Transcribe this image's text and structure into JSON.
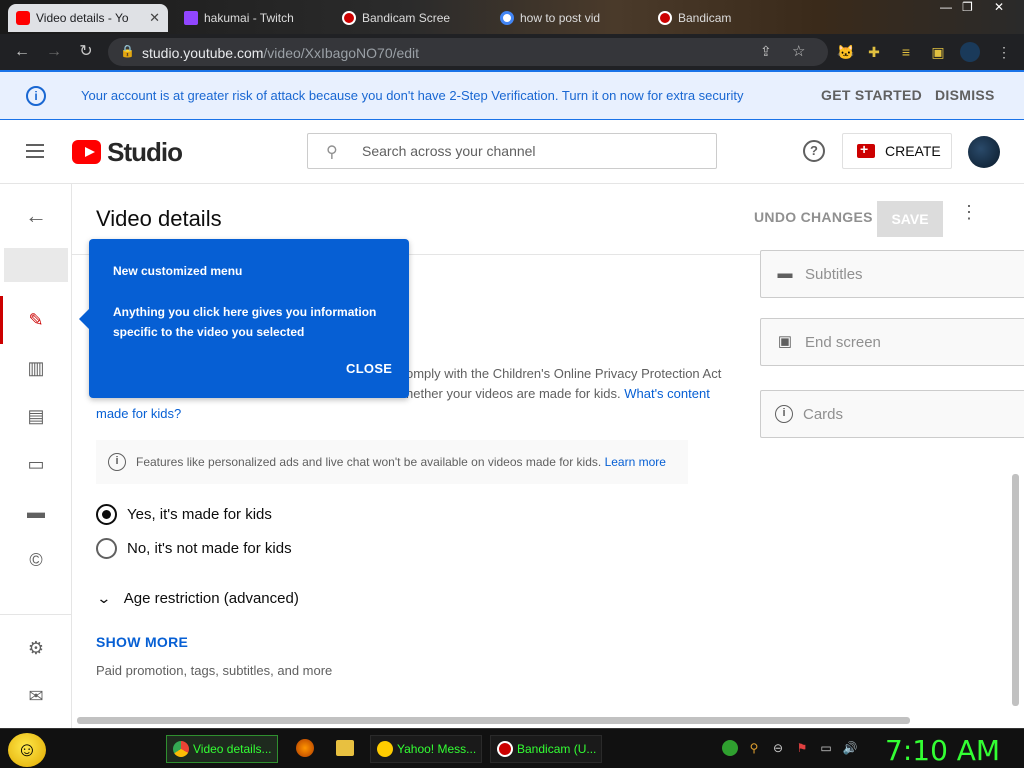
{
  "browser": {
    "tabs": [
      {
        "label": "Video details - Yo",
        "active": true,
        "favicon_color": "#ff0000"
      },
      {
        "label": "hakumai - Twitch",
        "active": false,
        "favicon_color": "#9146ff"
      },
      {
        "label": "Bandicam Scree",
        "active": false,
        "favicon_color": "#cc0000"
      },
      {
        "label": "how to post vid",
        "active": false,
        "favicon_color": "#4285f4"
      },
      {
        "label": "Bandicam",
        "active": false,
        "favicon_color": "#cc0000"
      }
    ],
    "url_host": "studio.youtube.com",
    "url_path": "/video/XxIbagoNO70/edit"
  },
  "banner": {
    "text": "Your account is at greater risk of attack because you don't have 2-Step Verification. Turn it on now for extra security",
    "get_started": "GET STARTED",
    "dismiss": "DISMISS"
  },
  "header": {
    "logo_text": "Studio",
    "search_placeholder": "Search across your channel",
    "help_glyph": "?",
    "create_label": "CREATE"
  },
  "page": {
    "title": "Video details",
    "undo": "UNDO CHANGES",
    "save": "SAVE"
  },
  "side_cards": [
    {
      "label": "Subtitles",
      "icon": "subtitles-icon"
    },
    {
      "label": "End screen",
      "icon": "end-screen-icon"
    },
    {
      "label": "Cards",
      "icon": "info-icon"
    }
  ],
  "audience": {
    "coppa_line1": "omply with the Children's Online Privacy Protection Act",
    "coppa_line2": "hether your videos are made for kids.",
    "coppa_link_a": "What's content",
    "coppa_link_b": "made for kids?",
    "note": "Features like personalized ads and live chat won't be available on videos made for kids.",
    "note_link": "Learn more",
    "yes_label": "Yes, it's made for kids",
    "no_label": "No, it's not made for kids",
    "selected": "yes",
    "age_restriction": "Age restriction (advanced)",
    "show_more": "SHOW MORE",
    "show_more_sub": "Paid promotion, tags, subtitles, and more"
  },
  "tooltip": {
    "title": "New customized menu",
    "body": "Anything you click here gives you information specific to the video you selected",
    "close": "CLOSE"
  },
  "taskbar": {
    "items": [
      {
        "label": "Video details...",
        "active": true,
        "icon_color": "#4285f4"
      },
      {
        "label": "Yahoo! Mess...",
        "active": false,
        "icon_color": "#ffcc00"
      },
      {
        "label": "Bandicam (U...",
        "active": false,
        "icon_color": "#cc0000"
      }
    ],
    "clock": "7:10 AM"
  },
  "colors": {
    "accent_blue": "#065fd4",
    "brand_red": "#ff0000",
    "taskbar_text": "#33ff33"
  }
}
